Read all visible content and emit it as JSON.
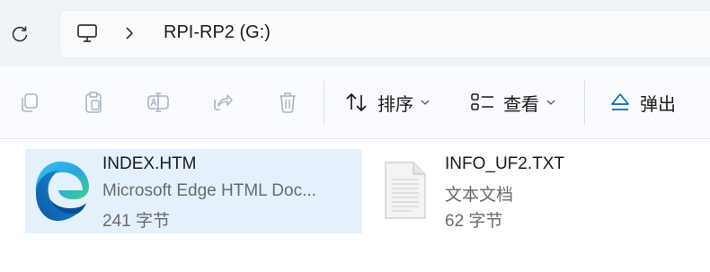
{
  "address": {
    "breadcrumb_root_icon": "computer-icon",
    "separator_icon": "chevron-right-icon",
    "current_location": "RPI-RP2 (G:)"
  },
  "toolbar": {
    "icons": [
      "copy-icon",
      "paste-icon",
      "rename-icon",
      "share-icon",
      "delete-icon"
    ],
    "sort_label": "排序",
    "view_label": "查看",
    "eject_label": "弹出"
  },
  "files": [
    {
      "name": "INDEX.HTM",
      "type": "Microsoft Edge HTML Doc...",
      "size": "241 字节",
      "icon": "edge-icon",
      "selected": true
    },
    {
      "name": "INFO_UF2.TXT",
      "type": "文本文档",
      "size": "62 字节",
      "icon": "text-document-icon",
      "selected": false
    }
  ],
  "colors": {
    "address_background": "#eff4f9",
    "selection": "#e4f0fc",
    "accent": "#0067c0"
  }
}
